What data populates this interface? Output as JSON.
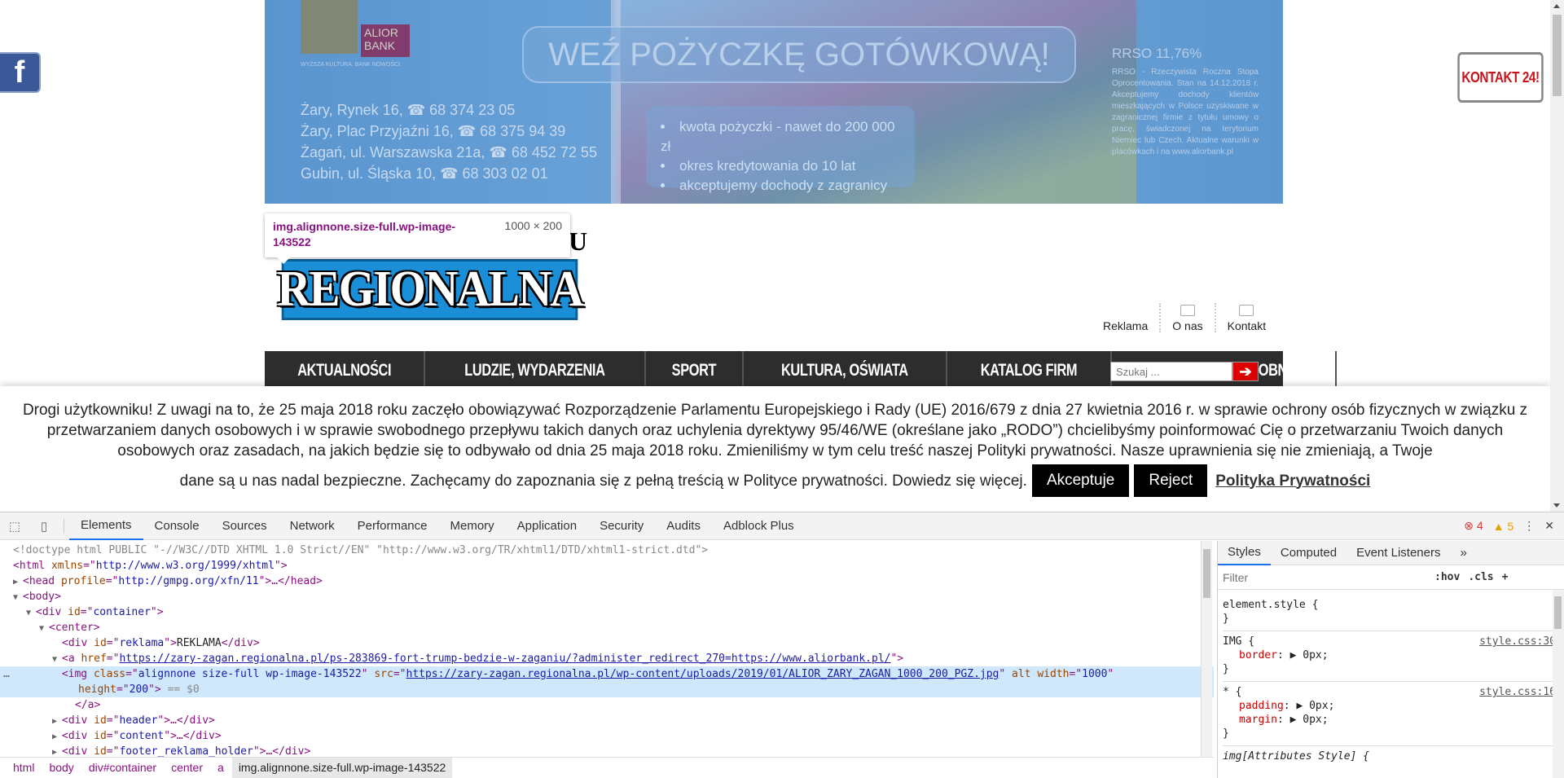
{
  "page": {
    "facebook_label": "f",
    "kontakt24": "KONTAKT 24!",
    "banner": {
      "bank_name": "ALIOR BANK",
      "motto": "WYŻSZA KULTURA. BANK NOWOŚCI.",
      "addresses": [
        "Żary, Rynek 16, ☎ 68 374 23 05",
        "Żary, Plac Przyjaźni 16, ☎ 68 375 94 39",
        "Żagań, ul. Warszawska 21a, ☎ 68 452 72 55",
        "Gubin, ul. Śląska 10, ☎ 68 303 02 01"
      ],
      "headline": "WEŹ POŻYCZKĘ GOTÓWKOWĄ!",
      "bullets": [
        "kwota pożyczki - nawet do 200 000 zł",
        "okres kredytowania do 10 lat",
        "akceptujemy dochody z zagranicy"
      ],
      "rrso": "RRSO 11,76%",
      "rrso_note": "RRSO - Rzeczywista Roczna Stopa Oprocentowania. Stan na 14.12.2018 r. Akceptujemy dochody klientów mieszkających w Polsce uzyskiwane w zagranicznej firmie z tytułu umowy o pracę, świadczonej na terytorium Niemiec lub Czech. Aktualne warunki w placówkach i na www.aliorbank.pl"
    },
    "tooltip": {
      "selector": "img.alignnone.size-full.wp-image-143522",
      "dims": "1000 × 200"
    },
    "logo_text": "REGIONALNA",
    "logo_fragment": "U",
    "top_links": [
      "Reklama",
      "O nas",
      "Kontakt"
    ],
    "nav": [
      "AKTUALNOŚCI",
      "LUDZIE, WYDARZENIA",
      "SPORT",
      "KULTURA, OŚWIATA",
      "KATALOG FIRM",
      "OGŁOSZENIA DROBNE"
    ],
    "search_placeholder": "Szukaj ...",
    "cookie": {
      "text": "Drogi użytkowniku! Z uwagi na to, że 25 maja 2018 roku zaczęło obowiązywać Rozporządzenie Parlamentu Europejskiego i Rady (UE) 2016/679 z dnia 27 kwietnia 2016 r. w sprawie ochrony osób fizycznych w związku z przetwarzaniem danych osobowych i w sprawie swobodnego przepływu takich danych oraz uchylenia dyrektywy 95/46/WE (określane jako „RODO”) chcielibyśmy poinformować Cię o przetwarzaniu Twoich danych osobowych oraz zasadach, na jakich będzie się to odbywało od dnia 25 maja 2018 roku. Zmieniliśmy w tym celu treść naszej Polityki prywatności. Nasze uprawnienia się nie zmieniają, a Twoje",
      "text_last": "dane są u nas nadal bezpieczne. Zachęcamy do zapoznania się z pełną treścią w Polityce prywatności. Dowiedz się więcej.",
      "accept": "Akceptuje",
      "reject": "Reject",
      "policy": "Polityka Prywatności"
    }
  },
  "devtools": {
    "tabs": [
      "Elements",
      "Console",
      "Sources",
      "Network",
      "Performance",
      "Memory",
      "Application",
      "Security",
      "Audits",
      "Adblock Plus"
    ],
    "errors": "4",
    "warnings": "5",
    "dom": {
      "doctype": "<!doctype html PUBLIC \"-//W3C//DTD XHTML 1.0 Strict//EN\" \"http://www.w3.org/TR/xhtml1/DTD/xhtml1-strict.dtd\">",
      "html_xmlns": "http://www.w3.org/1999/xhtml",
      "head_profile": "http://gmpg.org/xfn/11",
      "div_container": "container",
      "div_reklama": "reklama",
      "reklama_text": "REKLAMA",
      "a_href": "https://zary-zagan.regionalna.pl/ps-283869-fort-trump-bedzie-w-zaganiu/?administer_redirect_270=https://www.aliorbank.pl/",
      "img_class": "alignnone size-full wp-image-143522",
      "img_src": "https://zary-zagan.regionalna.pl/wp-content/uploads/2019/01/ALIOR_ZARY_ZAGAN_1000_200_PGZ.jpg",
      "img_width": "1000",
      "img_height": "200",
      "eq_dollar": "== $0",
      "div_header": "header",
      "div_content": "content",
      "div_footer": "footer_reklama_holder"
    },
    "breadcrumbs": [
      "html",
      "body",
      "div#container",
      "center",
      "a",
      "img.alignnone.size-full.wp-image-143522"
    ],
    "styles": {
      "tabs": [
        "Styles",
        "Computed",
        "Event Listeners"
      ],
      "filter_placeholder": "Filter",
      "hov": ":hov",
      "cls": ".cls",
      "rules": [
        {
          "selector": "element.style {",
          "source": "",
          "props": []
        },
        {
          "selector": "IMG {",
          "source": "style.css:30",
          "props": [
            {
              "name": "border",
              "value": "0px;"
            }
          ]
        },
        {
          "selector": "* {",
          "source": "style.css:16",
          "props": [
            {
              "name": "padding",
              "value": "0px;"
            },
            {
              "name": "margin",
              "value": "0px;"
            }
          ]
        },
        {
          "selector": "img[Attributes Style] {",
          "source": "",
          "props": []
        }
      ]
    }
  }
}
